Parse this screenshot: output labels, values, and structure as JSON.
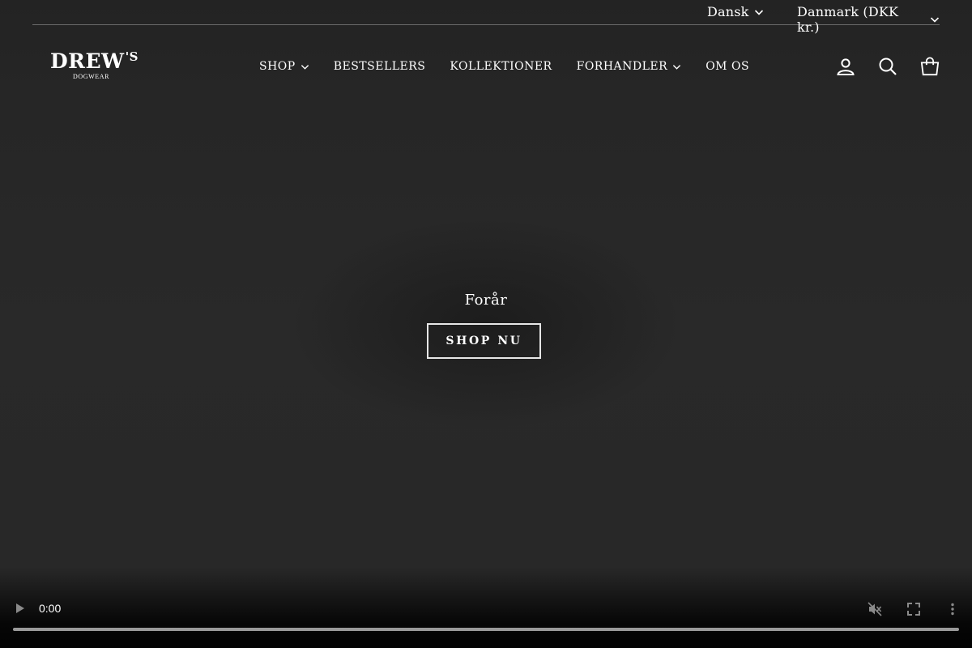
{
  "utility": {
    "language": "Dansk",
    "country": "Danmark (DKK kr.)"
  },
  "logo": {
    "main": "DREW",
    "sup": "'S",
    "sub": "DOGWEAR"
  },
  "nav": {
    "items": [
      {
        "label": "SHOP",
        "dropdown": true
      },
      {
        "label": "BESTSELLERS",
        "dropdown": false
      },
      {
        "label": "KOLLEKTIONER",
        "dropdown": false
      },
      {
        "label": "FORHANDLER",
        "dropdown": true
      },
      {
        "label": "OM OS",
        "dropdown": false
      }
    ]
  },
  "header_icons": [
    "account-icon",
    "search-icon",
    "cart-icon"
  ],
  "hero": {
    "title": "Forår",
    "button_label": "SHOP NU"
  },
  "video": {
    "time": "0:00",
    "progress": 0,
    "muted": true
  },
  "colors": {
    "background": "#2a2a2a",
    "text": "#ffffff",
    "button_border": "#e6e6e6"
  }
}
